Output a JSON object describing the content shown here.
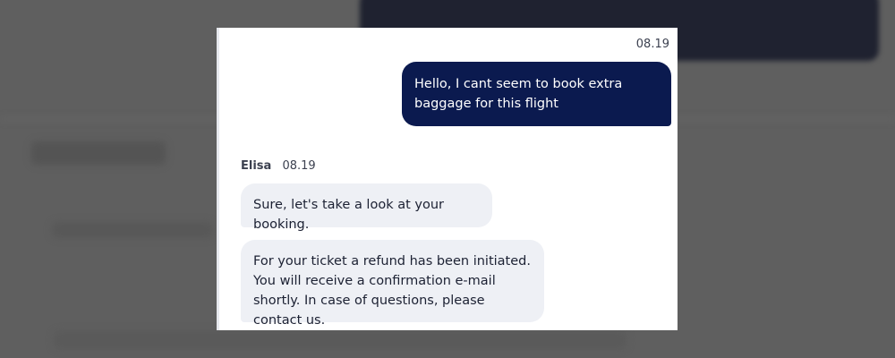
{
  "chat": {
    "user_message": {
      "time": "08.19",
      "text": "Hello, I cant seem to book extra baggage for this flight"
    },
    "agent": {
      "name": "Elisa",
      "time": "08.19"
    },
    "agent_messages": [
      {
        "text": "Sure, let's take a look at your booking."
      },
      {
        "text": "For your ticket a refund has been initiated. You will receive a confirmation e-mail shortly. In case of questions, please contact us."
      }
    ]
  },
  "colors": {
    "user_bubble": "#0b1a4f",
    "agent_bubble": "#eef0f5",
    "backdrop": "#5f5f5f"
  }
}
